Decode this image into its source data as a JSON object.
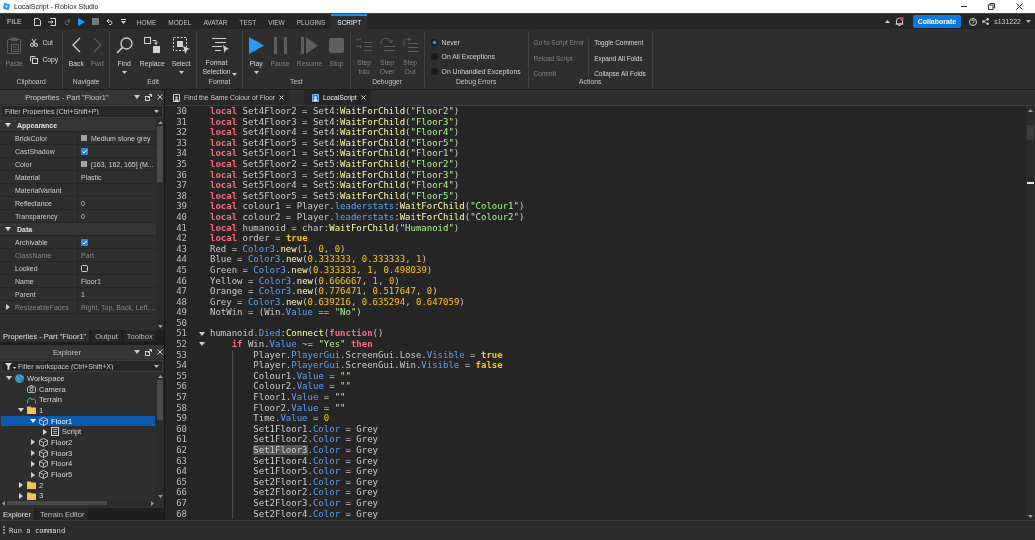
{
  "window": {
    "title": "LocalScript - Roblox Studio"
  },
  "menu_bar": {
    "file": "FILE",
    "quick_access": [
      {
        "kind": "new",
        "disabled": false
      },
      {
        "kind": "import",
        "disabled": false
      },
      {
        "kind": "redo",
        "disabled": true
      },
      {
        "kind": "play",
        "disabled": false
      },
      {
        "kind": "stop",
        "disabled": true
      },
      {
        "kind": "undo",
        "disabled": false
      },
      {
        "kind": "customize",
        "disabled": false
      }
    ],
    "tabs": [
      {
        "label": "HOME",
        "selected": false
      },
      {
        "label": "MODEL",
        "selected": false
      },
      {
        "label": "AVATAR",
        "selected": false
      },
      {
        "label": "TEST",
        "selected": false
      },
      {
        "label": "VIEW",
        "selected": false
      },
      {
        "label": "PLUGINS",
        "selected": false
      },
      {
        "label": "SCRIPT",
        "selected": true
      }
    ],
    "notification": true,
    "collaborate": "Collaborate",
    "user": "s131222"
  },
  "ribbon": {
    "groups": [
      {
        "title": "Clipboard",
        "kind": "buttons",
        "buttons": [
          {
            "kind": "paste",
            "label": "Paste",
            "disabled": true,
            "dropdown": false
          },
          {
            "kind": "cut",
            "label": "Cut",
            "disabled": false,
            "dropdown": false
          },
          {
            "kind": "copy",
            "label": "Copy",
            "disabled": false,
            "dropdown": false
          }
        ]
      },
      {
        "title": "Navigate",
        "kind": "buttons",
        "buttons": [
          {
            "kind": "back",
            "label": "Back",
            "disabled": false,
            "dropdown": false
          },
          {
            "kind": "forward",
            "label": "Fwd",
            "disabled": true,
            "dropdown": false
          }
        ]
      },
      {
        "title": "Edit",
        "kind": "buttons",
        "buttons": [
          {
            "kind": "find",
            "label": "Find",
            "disabled": false,
            "dropdown": true
          },
          {
            "kind": "replace",
            "label": "Replace",
            "disabled": false,
            "dropdown": false
          },
          {
            "kind": "select",
            "label": "Select",
            "disabled": false,
            "dropdown": true
          }
        ]
      },
      {
        "title": "Format",
        "kind": "buttons",
        "buttons": [
          {
            "kind": "format",
            "label": "Format Selection",
            "disabled": false,
            "dropdown": true
          }
        ]
      },
      {
        "title": "Test",
        "kind": "buttons",
        "buttons": [
          {
            "kind": "play",
            "label": "Play",
            "disabled": false,
            "dropdown": true
          },
          {
            "kind": "pause",
            "label": "Pause",
            "disabled": true,
            "dropdown": false
          },
          {
            "kind": "resume",
            "label": "Resume",
            "disabled": true,
            "dropdown": false
          },
          {
            "kind": "stop",
            "label": "Stop",
            "disabled": true,
            "dropdown": false
          }
        ]
      },
      {
        "title": "Debugger",
        "kind": "buttons",
        "buttons": [
          {
            "kind": "step-into",
            "label": "Step Into",
            "disabled": true,
            "dropdown": false
          },
          {
            "kind": "step-over",
            "label": "Step Over",
            "disabled": true,
            "dropdown": false
          },
          {
            "kind": "step-out",
            "label": "Step Out",
            "disabled": true,
            "dropdown": false
          }
        ]
      },
      {
        "title": "Debug Errors",
        "kind": "radios",
        "options": [
          {
            "label": "Never",
            "selected": true
          },
          {
            "label": "On All Exceptions",
            "selected": false
          },
          {
            "label": "On Unhandled Exceptions",
            "selected": false
          }
        ]
      },
      {
        "title": "Actions",
        "kind": "actions",
        "columns": [
          [
            {
              "label": "Go to Script Error",
              "disabled": true
            },
            {
              "label": "Reload Script",
              "disabled": true
            },
            {
              "label": "Commit",
              "disabled": true
            }
          ],
          [
            {
              "label": "Toggle Comment",
              "disabled": false
            },
            {
              "label": "Expand All Folds",
              "disabled": false
            },
            {
              "label": "Collapse All Folds",
              "disabled": false
            }
          ]
        ]
      }
    ]
  },
  "properties": {
    "title": "Properties - Part \"Floor1\"",
    "filter": {
      "placeholder": "Filter Properties (Ctrl+Shift+P)"
    },
    "sections": [
      {
        "title": "Appearance",
        "expanded": true,
        "rows": [
          {
            "name": "BrickColor",
            "kind": "color",
            "value": "Medium stone grey",
            "color": "#a3a2a5",
            "disabled": false
          },
          {
            "name": "CastShadow",
            "kind": "checkbox",
            "checked": true,
            "disabled": false
          },
          {
            "name": "Color",
            "kind": "color",
            "value": "[163, 162, 165] (M...",
            "color": "#a3a2a5",
            "disabled": false
          },
          {
            "name": "Material",
            "kind": "text",
            "value": "Plastic",
            "disabled": false
          },
          {
            "name": "MaterialVariant",
            "kind": "text",
            "disabled": false
          },
          {
            "name": "Reflectance",
            "kind": "text",
            "value": "0",
            "disabled": false
          },
          {
            "name": "Transparency",
            "kind": "text",
            "value": "0",
            "disabled": false
          }
        ]
      },
      {
        "title": "Data",
        "expanded": true,
        "rows": [
          {
            "name": "Archivable",
            "kind": "checkbox",
            "checked": true,
            "disabled": false
          },
          {
            "name": "ClassName",
            "kind": "text",
            "value": "Part",
            "disabled": true
          },
          {
            "name": "Locked",
            "kind": "checkbox",
            "checked": false,
            "disabled": false
          },
          {
            "name": "Name",
            "kind": "text",
            "value": "Floor1",
            "disabled": false
          },
          {
            "name": "Parent",
            "kind": "text",
            "value": "1",
            "disabled": false
          },
          {
            "name": "ResizeableFaces",
            "kind": "expandable",
            "value": "Right, Top, Back, Left,...",
            "expanded": false,
            "disabled": true
          }
        ]
      }
    ],
    "tabs": [
      {
        "label": "Properties - Part \"Floor1\"",
        "selected": true
      },
      {
        "label": "Output",
        "selected": false
      },
      {
        "label": "Toolbox",
        "selected": false
      }
    ]
  },
  "explorer": {
    "title": "Explorer",
    "filter": {
      "placeholder": "Filter workspace (Ctrl+Shift+X)"
    },
    "tree": [
      {
        "label": "Workspace",
        "kind": "workspace",
        "expanded": true,
        "selected": false,
        "children": [
          {
            "label": "Camera",
            "kind": "camera",
            "selected": false
          },
          {
            "label": "Terrain",
            "kind": "terrain",
            "selected": false
          },
          {
            "label": "1",
            "kind": "folder",
            "expanded": true,
            "selected": false,
            "children": [
              {
                "label": "Floor1",
                "kind": "part",
                "expanded": true,
                "selected": true,
                "children": [
                  {
                    "label": "Script",
                    "kind": "script",
                    "expanded": false,
                    "selected": false
                  }
                ]
              },
              {
                "label": "Floor2",
                "kind": "part",
                "expanded": false,
                "selected": false
              },
              {
                "label": "Floor3",
                "kind": "part",
                "expanded": false,
                "selected": false
              },
              {
                "label": "Floor4",
                "kind": "part",
                "expanded": false,
                "selected": false
              },
              {
                "label": "Floor5",
                "kind": "part",
                "expanded": false,
                "selected": false
              }
            ]
          },
          {
            "label": "2",
            "kind": "folder",
            "expanded": false,
            "selected": false
          },
          {
            "label": "3",
            "kind": "folder",
            "expanded": false,
            "selected": false
          }
        ]
      }
    ],
    "tabs": [
      {
        "label": "Explorer",
        "selected": true
      },
      {
        "label": "Terrain Editor",
        "selected": false
      }
    ]
  },
  "editor": {
    "tabs": [
      {
        "title": "Find the Same Colour of Floor",
        "kind": "script",
        "selected": false
      },
      {
        "title": "LocalScript",
        "kind": "local-script",
        "selected": true
      }
    ],
    "lines": [
      {
        "number": "30",
        "tokens": [
          {
            "kind": "keyword",
            "text": "local"
          },
          {
            "kind": "plain",
            "text": " Set4Floor2 = Set4:"
          },
          {
            "kind": "method",
            "text": "WaitForChild"
          },
          {
            "kind": "plain",
            "text": "("
          },
          {
            "kind": "string",
            "text": "\"Floor2\""
          },
          {
            "kind": "plain",
            "text": ")"
          }
        ]
      },
      {
        "number": "31",
        "tokens": [
          {
            "kind": "keyword",
            "text": "local"
          },
          {
            "kind": "plain",
            "text": " Set4Floor3 = Set4:"
          },
          {
            "kind": "method",
            "text": "WaitForChild"
          },
          {
            "kind": "plain",
            "text": "("
          },
          {
            "kind": "string",
            "text": "\"Floor3\""
          },
          {
            "kind": "plain",
            "text": ")"
          }
        ]
      },
      {
        "number": "32",
        "tokens": [
          {
            "kind": "keyword",
            "text": "local"
          },
          {
            "kind": "plain",
            "text": " Set4Floor4 = Set4:"
          },
          {
            "kind": "method",
            "text": "WaitForChild"
          },
          {
            "kind": "plain",
            "text": "("
          },
          {
            "kind": "string",
            "text": "\"Floor4\""
          },
          {
            "kind": "plain",
            "text": ")"
          }
        ]
      },
      {
        "number": "33",
        "tokens": [
          {
            "kind": "keyword",
            "text": "local"
          },
          {
            "kind": "plain",
            "text": " Set4Floor5 = Set4:"
          },
          {
            "kind": "method",
            "text": "WaitForChild"
          },
          {
            "kind": "plain",
            "text": "("
          },
          {
            "kind": "string",
            "text": "\"Floor5\""
          },
          {
            "kind": "plain",
            "text": ")"
          }
        ]
      },
      {
        "number": "34",
        "tokens": [
          {
            "kind": "keyword",
            "text": "local"
          },
          {
            "kind": "plain",
            "text": " Set5Floor1 = Set5:"
          },
          {
            "kind": "method",
            "text": "WaitForChild"
          },
          {
            "kind": "plain",
            "text": "("
          },
          {
            "kind": "string",
            "text": "\"Floor1\""
          },
          {
            "kind": "plain",
            "text": ")"
          }
        ]
      },
      {
        "number": "35",
        "tokens": [
          {
            "kind": "keyword",
            "text": "local"
          },
          {
            "kind": "plain",
            "text": " Set5Floor2 = Set5:"
          },
          {
            "kind": "method",
            "text": "WaitForChild"
          },
          {
            "kind": "plain",
            "text": "("
          },
          {
            "kind": "string",
            "text": "\"Floor2\""
          },
          {
            "kind": "plain",
            "text": ")"
          }
        ]
      },
      {
        "number": "36",
        "tokens": [
          {
            "kind": "keyword",
            "text": "local"
          },
          {
            "kind": "plain",
            "text": " Set5Floor3 = Set5:"
          },
          {
            "kind": "method",
            "text": "WaitForChild"
          },
          {
            "kind": "plain",
            "text": "("
          },
          {
            "kind": "string",
            "text": "\"Floor3\""
          },
          {
            "kind": "plain",
            "text": ")"
          }
        ]
      },
      {
        "number": "37",
        "tokens": [
          {
            "kind": "keyword",
            "text": "local"
          },
          {
            "kind": "plain",
            "text": " Set5Floor4 = Set5:"
          },
          {
            "kind": "method",
            "text": "WaitForChild"
          },
          {
            "kind": "plain",
            "text": "("
          },
          {
            "kind": "string",
            "text": "\"Floor4\""
          },
          {
            "kind": "plain",
            "text": ")"
          }
        ]
      },
      {
        "number": "38",
        "tokens": [
          {
            "kind": "keyword",
            "text": "local"
          },
          {
            "kind": "plain",
            "text": " Set5Floor5 = Set5:"
          },
          {
            "kind": "method",
            "text": "WaitForChild"
          },
          {
            "kind": "plain",
            "text": "("
          },
          {
            "kind": "string",
            "text": "\"Floor5\""
          },
          {
            "kind": "plain",
            "text": ")"
          }
        ]
      },
      {
        "number": "39",
        "tokens": [
          {
            "kind": "keyword",
            "text": "local"
          },
          {
            "kind": "plain",
            "text": " colour1 = Player."
          },
          {
            "kind": "property",
            "text": "leaderstats"
          },
          {
            "kind": "plain",
            "text": ":"
          },
          {
            "kind": "method",
            "text": "WaitForChild"
          },
          {
            "kind": "plain",
            "text": "("
          },
          {
            "kind": "string",
            "text": "\"Colour1\""
          },
          {
            "kind": "plain",
            "text": ")"
          }
        ]
      },
      {
        "number": "40",
        "tokens": [
          {
            "kind": "keyword",
            "text": "local"
          },
          {
            "kind": "plain",
            "text": " colour2 = Player."
          },
          {
            "kind": "property",
            "text": "leaderstats"
          },
          {
            "kind": "plain",
            "text": ":"
          },
          {
            "kind": "method",
            "text": "WaitForChild"
          },
          {
            "kind": "plain",
            "text": "("
          },
          {
            "kind": "string",
            "text": "\"Colour2\""
          },
          {
            "kind": "plain",
            "text": ")"
          }
        ]
      },
      {
        "number": "41",
        "tokens": [
          {
            "kind": "keyword",
            "text": "local"
          },
          {
            "kind": "plain",
            "text": " humanoid = char:"
          },
          {
            "kind": "method",
            "text": "WaitForChild"
          },
          {
            "kind": "plain",
            "text": "("
          },
          {
            "kind": "string",
            "text": "\"Humanoid\""
          },
          {
            "kind": "plain",
            "text": ")"
          }
        ]
      },
      {
        "number": "42",
        "tokens": [
          {
            "kind": "keyword",
            "text": "local"
          },
          {
            "kind": "plain",
            "text": " order = "
          },
          {
            "kind": "bool",
            "text": "true"
          }
        ]
      },
      {
        "number": "43",
        "tokens": [
          {
            "kind": "plain",
            "text": "Red = "
          },
          {
            "kind": "property",
            "text": "Color3"
          },
          {
            "kind": "plain",
            "text": "."
          },
          {
            "kind": "method",
            "text": "new"
          },
          {
            "kind": "plain",
            "text": "("
          },
          {
            "kind": "number",
            "text": "1"
          },
          {
            "kind": "plain",
            "text": ", "
          },
          {
            "kind": "number",
            "text": "0"
          },
          {
            "kind": "plain",
            "text": ", "
          },
          {
            "kind": "number",
            "text": "0"
          },
          {
            "kind": "plain",
            "text": ")"
          }
        ]
      },
      {
        "number": "44",
        "tokens": [
          {
            "kind": "plain",
            "text": "Blue = "
          },
          {
            "kind": "property",
            "text": "Color3"
          },
          {
            "kind": "plain",
            "text": "."
          },
          {
            "kind": "method",
            "text": "new"
          },
          {
            "kind": "plain",
            "text": "("
          },
          {
            "kind": "number",
            "text": "0.333333"
          },
          {
            "kind": "plain",
            "text": ", "
          },
          {
            "kind": "number",
            "text": "0.333333"
          },
          {
            "kind": "plain",
            "text": ", "
          },
          {
            "kind": "number",
            "text": "1"
          },
          {
            "kind": "plain",
            "text": ")"
          }
        ]
      },
      {
        "number": "45",
        "tokens": [
          {
            "kind": "plain",
            "text": "Green = "
          },
          {
            "kind": "property",
            "text": "Color3"
          },
          {
            "kind": "plain",
            "text": "."
          },
          {
            "kind": "method",
            "text": "new"
          },
          {
            "kind": "plain",
            "text": "("
          },
          {
            "kind": "number",
            "text": "0.333333"
          },
          {
            "kind": "plain",
            "text": ", "
          },
          {
            "kind": "number",
            "text": "1"
          },
          {
            "kind": "plain",
            "text": ", "
          },
          {
            "kind": "number",
            "text": "0.498039"
          },
          {
            "kind": "plain",
            "text": ")"
          }
        ]
      },
      {
        "number": "46",
        "tokens": [
          {
            "kind": "plain",
            "text": "Yellow = "
          },
          {
            "kind": "property",
            "text": "Color3"
          },
          {
            "kind": "plain",
            "text": "."
          },
          {
            "kind": "method",
            "text": "new"
          },
          {
            "kind": "plain",
            "text": "("
          },
          {
            "kind": "number",
            "text": "0.666667"
          },
          {
            "kind": "plain",
            "text": ", "
          },
          {
            "kind": "number",
            "text": "1"
          },
          {
            "kind": "plain",
            "text": ", "
          },
          {
            "kind": "number",
            "text": "0"
          },
          {
            "kind": "plain",
            "text": ")"
          }
        ]
      },
      {
        "number": "47",
        "tokens": [
          {
            "kind": "plain",
            "text": "Orange = "
          },
          {
            "kind": "property",
            "text": "Color3"
          },
          {
            "kind": "plain",
            "text": "."
          },
          {
            "kind": "method",
            "text": "new"
          },
          {
            "kind": "plain",
            "text": "("
          },
          {
            "kind": "number",
            "text": "0.776471"
          },
          {
            "kind": "plain",
            "text": ", "
          },
          {
            "kind": "number",
            "text": "0.517647"
          },
          {
            "kind": "plain",
            "text": ", "
          },
          {
            "kind": "number",
            "text": "0"
          },
          {
            "kind": "plain",
            "text": ")"
          }
        ]
      },
      {
        "number": "48",
        "tokens": [
          {
            "kind": "plain",
            "text": "Grey = "
          },
          {
            "kind": "property",
            "text": "Color3"
          },
          {
            "kind": "plain",
            "text": "."
          },
          {
            "kind": "method",
            "text": "new"
          },
          {
            "kind": "plain",
            "text": "("
          },
          {
            "kind": "number",
            "text": "0.639216"
          },
          {
            "kind": "plain",
            "text": ", "
          },
          {
            "kind": "number",
            "text": "0.635294"
          },
          {
            "kind": "plain",
            "text": ", "
          },
          {
            "kind": "number",
            "text": "0.647059"
          },
          {
            "kind": "plain",
            "text": ")"
          }
        ]
      },
      {
        "number": "49",
        "tokens": [
          {
            "kind": "plain",
            "text": "NotWin = (Win."
          },
          {
            "kind": "property",
            "text": "Value"
          },
          {
            "kind": "plain",
            "text": " == "
          },
          {
            "kind": "string",
            "text": "\"No\""
          },
          {
            "kind": "plain",
            "text": ")"
          }
        ]
      },
      {
        "number": "50"
      },
      {
        "number": "51",
        "expanded": true,
        "tokens": [
          {
            "kind": "plain",
            "text": "humanoid."
          },
          {
            "kind": "property",
            "text": "Died"
          },
          {
            "kind": "plain",
            "text": ":"
          },
          {
            "kind": "method",
            "text": "Connect"
          },
          {
            "kind": "plain",
            "text": "("
          },
          {
            "kind": "keyword",
            "text": "function"
          },
          {
            "kind": "plain",
            "text": "()"
          }
        ],
        "children": [
          {
            "number": "52",
            "expanded": true,
            "tokens": [
              {
                "kind": "keyword",
                "text": "if"
              },
              {
                "kind": "plain",
                "text": " Win."
              },
              {
                "kind": "property",
                "text": "Value"
              },
              {
                "kind": "plain",
                "text": " ~= "
              },
              {
                "kind": "string",
                "text": "\"Yes\""
              },
              {
                "kind": "keyword",
                "text": " then"
              }
            ],
            "children": [
              {
                "number": "53",
                "tokens": [
                  {
                    "kind": "plain",
                    "text": "Player."
                  },
                  {
                    "kind": "property",
                    "text": "PlayerGui"
                  },
                  {
                    "kind": "plain",
                    "text": ".ScreenGui.Lose."
                  },
                  {
                    "kind": "property",
                    "text": "Visible"
                  },
                  {
                    "kind": "plain",
                    "text": " = "
                  },
                  {
                    "kind": "bool",
                    "text": "true"
                  }
                ]
              },
              {
                "number": "54",
                "tokens": [
                  {
                    "kind": "plain",
                    "text": "Player."
                  },
                  {
                    "kind": "property",
                    "text": "PlayerGui"
                  },
                  {
                    "kind": "plain",
                    "text": ".ScreenGui.Win."
                  },
                  {
                    "kind": "property",
                    "text": "Visible"
                  },
                  {
                    "kind": "plain",
                    "text": " = "
                  },
                  {
                    "kind": "bool",
                    "text": "false"
                  }
                ]
              },
              {
                "number": "55",
                "tokens": [
                  {
                    "kind": "plain",
                    "text": "Colour1."
                  },
                  {
                    "kind": "property",
                    "text": "Value"
                  },
                  {
                    "kind": "plain",
                    "text": " = "
                  },
                  {
                    "kind": "string",
                    "text": "\"\""
                  }
                ]
              },
              {
                "number": "56",
                "tokens": [
                  {
                    "kind": "plain",
                    "text": "Colour2."
                  },
                  {
                    "kind": "property",
                    "text": "Value"
                  },
                  {
                    "kind": "plain",
                    "text": " = "
                  },
                  {
                    "kind": "string",
                    "text": "\"\""
                  }
                ]
              },
              {
                "number": "57",
                "tokens": [
                  {
                    "kind": "plain",
                    "text": "Floor1."
                  },
                  {
                    "kind": "property",
                    "text": "Value"
                  },
                  {
                    "kind": "plain",
                    "text": " = "
                  },
                  {
                    "kind": "string",
                    "text": "\"\""
                  }
                ]
              },
              {
                "number": "58",
                "tokens": [
                  {
                    "kind": "plain",
                    "text": "Floor2."
                  },
                  {
                    "kind": "property",
                    "text": "Value"
                  },
                  {
                    "kind": "plain",
                    "text": " = "
                  },
                  {
                    "kind": "string",
                    "text": "\"\""
                  }
                ]
              },
              {
                "number": "59",
                "tokens": [
                  {
                    "kind": "plain",
                    "text": "Time."
                  },
                  {
                    "kind": "property",
                    "text": "Value"
                  },
                  {
                    "kind": "plain",
                    "text": " = "
                  },
                  {
                    "kind": "number",
                    "text": "0"
                  }
                ]
              },
              {
                "number": "60",
                "tokens": [
                  {
                    "kind": "plain",
                    "text": "Set1Floor1."
                  },
                  {
                    "kind": "property",
                    "text": "Color"
                  },
                  {
                    "kind": "plain",
                    "text": " = Grey"
                  }
                ]
              },
              {
                "number": "61",
                "tokens": [
                  {
                    "kind": "plain",
                    "text": "Set1Floor2."
                  },
                  {
                    "kind": "property",
                    "text": "Color"
                  },
                  {
                    "kind": "plain",
                    "text": " = Grey"
                  }
                ]
              },
              {
                "number": "62",
                "tokens": [
                  {
                    "kind": "selection",
                    "text": "Set1Floor3"
                  },
                  {
                    "kind": "plain",
                    "text": "."
                  },
                  {
                    "kind": "property",
                    "text": "Color"
                  },
                  {
                    "kind": "plain",
                    "text": " = Grey"
                  }
                ]
              },
              {
                "number": "63",
                "tokens": [
                  {
                    "kind": "plain",
                    "text": "Set1Floor4."
                  },
                  {
                    "kind": "property",
                    "text": "Color"
                  },
                  {
                    "kind": "plain",
                    "text": " = Grey"
                  }
                ]
              },
              {
                "number": "64",
                "tokens": [
                  {
                    "kind": "plain",
                    "text": "Set1Floor5."
                  },
                  {
                    "kind": "property",
                    "text": "Color"
                  },
                  {
                    "kind": "plain",
                    "text": " = Grey"
                  }
                ]
              },
              {
                "number": "65",
                "tokens": [
                  {
                    "kind": "plain",
                    "text": "Set2Floor1."
                  },
                  {
                    "kind": "property",
                    "text": "Color"
                  },
                  {
                    "kind": "plain",
                    "text": " = Grey"
                  }
                ]
              },
              {
                "number": "66",
                "tokens": [
                  {
                    "kind": "plain",
                    "text": "Set2Floor2."
                  },
                  {
                    "kind": "property",
                    "text": "Color"
                  },
                  {
                    "kind": "plain",
                    "text": " = Grey"
                  }
                ]
              },
              {
                "number": "67",
                "tokens": [
                  {
                    "kind": "plain",
                    "text": "Set2Floor3."
                  },
                  {
                    "kind": "property",
                    "text": "Color"
                  },
                  {
                    "kind": "plain",
                    "text": " = Grey"
                  }
                ]
              },
              {
                "number": "68",
                "tokens": [
                  {
                    "kind": "plain",
                    "text": "Set2Floor4."
                  },
                  {
                    "kind": "property",
                    "text": "Color"
                  },
                  {
                    "kind": "plain",
                    "text": " = Grey"
                  }
                ]
              }
            ]
          }
        ]
      }
    ]
  },
  "command_bar": {
    "placeholder": "Run a command"
  }
}
